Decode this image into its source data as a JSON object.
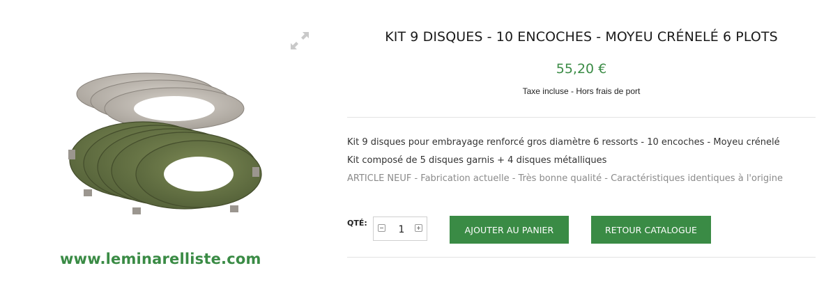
{
  "product": {
    "title": "KIT 9 DISQUES - 10 ENCOCHES - MOYEU CRÉNELÉ 6 PLOTS",
    "price": "55,20 €",
    "tax_note": "Taxe incluse - Hors frais de port",
    "description": [
      "Kit 9 disques pour embrayage renforcé gros diamètre 6 ressorts - 10 encoches - Moyeu crénelé",
      "Kit composé de 5 disques garnis + 4 disques métalliques"
    ],
    "condition_note": "ARTICLE NEUF - Fabrication actuelle - Très bonne qualité - Caractéristiques identiques à l'origine",
    "website_watermark": "www.leminarelliste.com"
  },
  "purchase": {
    "qty_label": "QTÉ:",
    "qty_value": "1",
    "add_to_cart_label": "AJOUTER AU PANIER",
    "back_to_catalog_label": "RETOUR CATALOGUE"
  },
  "icons": {
    "zoom": "expand-arrows-icon",
    "qty_minus": "minus-square-icon",
    "qty_plus": "plus-square-icon"
  },
  "colors": {
    "accent": "#3a8b45",
    "divider": "#e3e3e3",
    "muted_text": "#8a8a8a"
  }
}
